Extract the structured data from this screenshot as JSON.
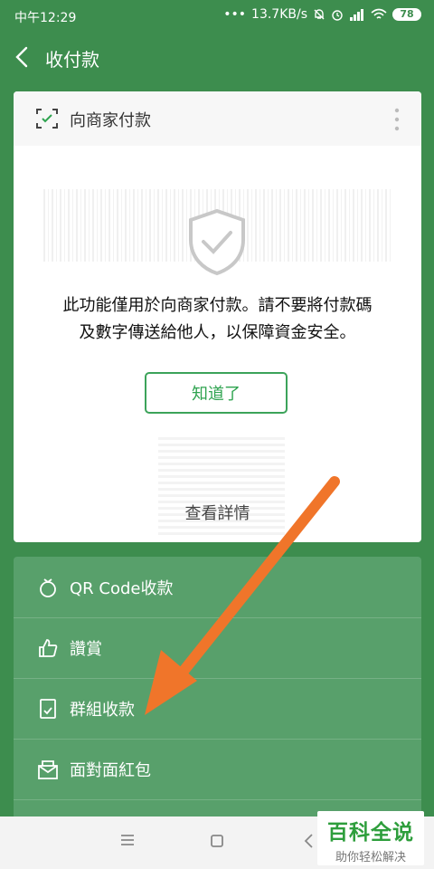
{
  "status_bar": {
    "time": "中午12:29",
    "network_speed": "13.7KB/s",
    "battery": "78"
  },
  "header": {
    "title": "收付款"
  },
  "card": {
    "header_label": "向商家付款",
    "notice_line1": "此功能僅用於向商家付款。請不要將付款碼",
    "notice_line2": "及數字傳送給他人，以保障資金安全。",
    "ok_button": "知道了",
    "details_link": "查看詳情"
  },
  "menu": {
    "items": [
      {
        "label": "QR Code收款",
        "icon": "qr-money-icon"
      },
      {
        "label": "讚賞",
        "icon": "thumbs-up-icon"
      },
      {
        "label": "群組收款",
        "icon": "group-receipt-icon"
      },
      {
        "label": "面對面紅包",
        "icon": "red-envelope-icon"
      }
    ]
  },
  "watermark": {
    "title": "百科全说",
    "subtitle": "助你轻松解决"
  },
  "colors": {
    "background": "#3d8d4e",
    "menu_bg": "#58a06b",
    "accent_green": "#2ea34f",
    "arrow": "#f0752a"
  }
}
